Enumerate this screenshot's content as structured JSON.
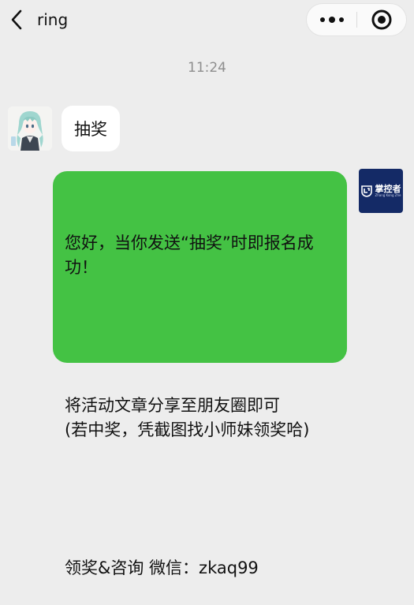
{
  "header": {
    "title": "ring",
    "back_icon": "chevron-left-icon",
    "more_icon": "more-dots-icon",
    "close_icon": "target-circle-icon"
  },
  "timestamp": "11:24",
  "messages": [
    {
      "direction": "incoming",
      "text": "抽奖"
    },
    {
      "direction": "outgoing",
      "paragraphs": [
        "您好，当你发送“抽奖”时即报名成功！",
        "将活动文章分享至朋友圈即可\n(若中奖，凭截图找小师妹领奖哈)",
        "领奖&咨询 微信：zkaq99"
      ]
    }
  ],
  "avatars": {
    "left_icon": "anime-character-avatar",
    "right_logo_cn": "掌控者",
    "right_logo_en": "Zhang Kong Zhe"
  },
  "colors": {
    "background": "#ededed",
    "outgoing_bubble": "#44c244",
    "incoming_bubble": "#ffffff",
    "logo_bg": "#142a66"
  }
}
